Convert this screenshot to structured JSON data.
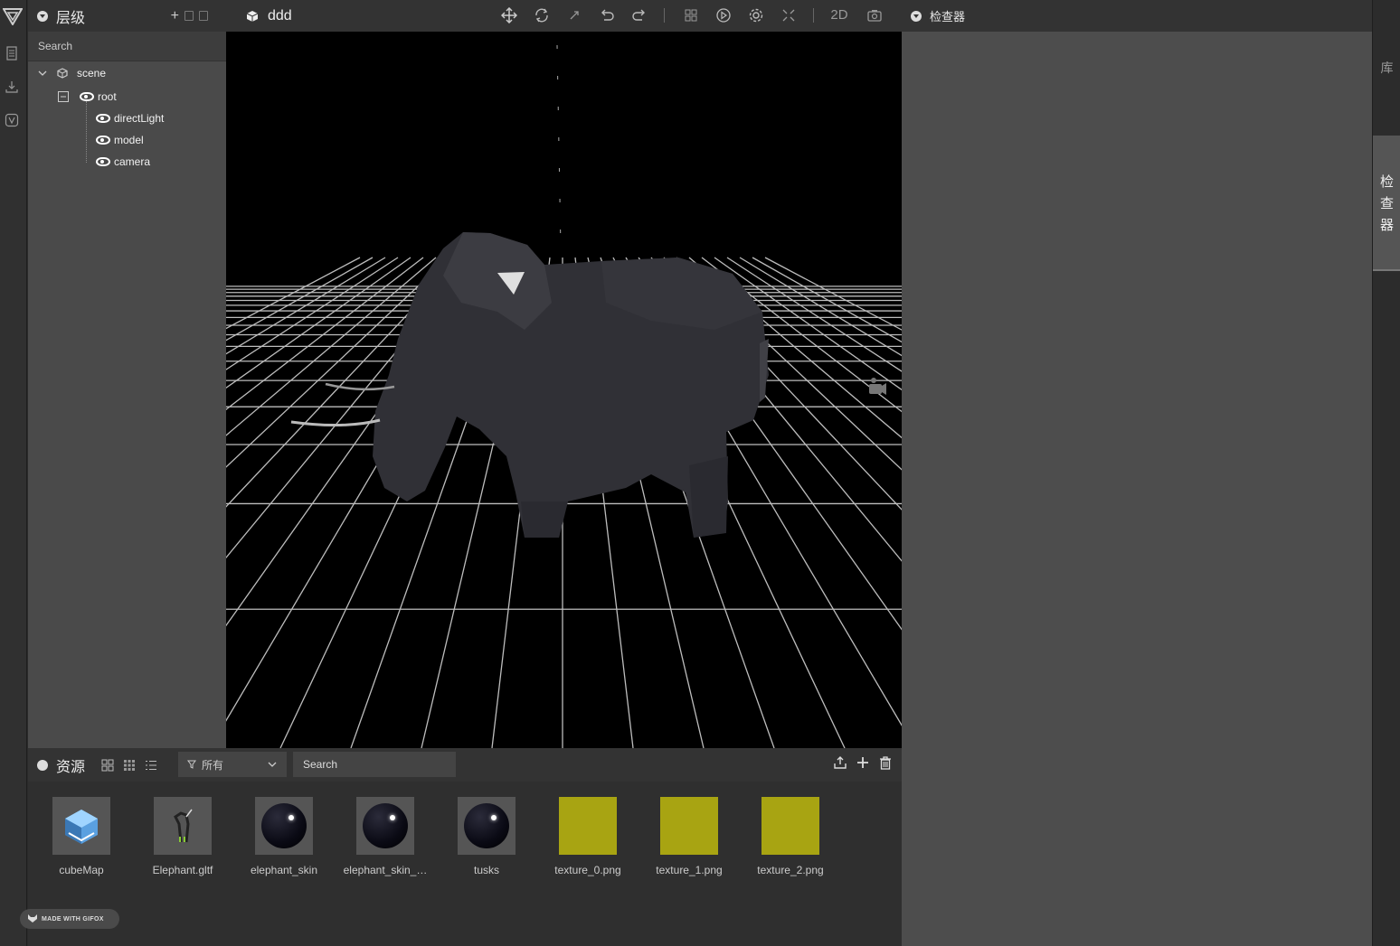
{
  "hierarchy": {
    "title": "层级",
    "add_icon": "+",
    "search_placeholder": "Search",
    "tree": {
      "scene": "scene",
      "root": "root",
      "children": [
        "directLight",
        "model",
        "camera"
      ]
    }
  },
  "scene_tab": {
    "title": "ddd",
    "mode_2d": "2D",
    "icons": [
      "move-icon",
      "rotate-icon",
      "scale-icon",
      "undo-icon",
      "redo-icon",
      "grid-icon",
      "play-icon",
      "settings-icon",
      "fullscreen-icon",
      "camera-icon"
    ]
  },
  "assets": {
    "title": "资源",
    "filter_label": "所有",
    "search_placeholder": "Search",
    "items": [
      {
        "name": "cubeMap",
        "kind": "cubemap"
      },
      {
        "name": "Elephant.gltf",
        "kind": "model"
      },
      {
        "name": "elephant_skin",
        "kind": "material"
      },
      {
        "name": "elephant_skin_…",
        "kind": "material"
      },
      {
        "name": "tusks",
        "kind": "material"
      },
      {
        "name": "texture_0.png",
        "kind": "texture",
        "color": "#a8a412"
      },
      {
        "name": "texture_1.png",
        "kind": "texture",
        "color": "#a8a412"
      },
      {
        "name": "texture_2.png",
        "kind": "texture",
        "color": "#a8a412"
      }
    ]
  },
  "inspector": {
    "title": "检查器"
  },
  "right_tabs": {
    "library": "库",
    "inspector": "检查器"
  },
  "watermark": "MADE WITH GIFOX",
  "colors": {
    "texture_yellow": "#a8a412",
    "panel_bg": "#4a4a4a",
    "viewport_bg": "#000000"
  }
}
